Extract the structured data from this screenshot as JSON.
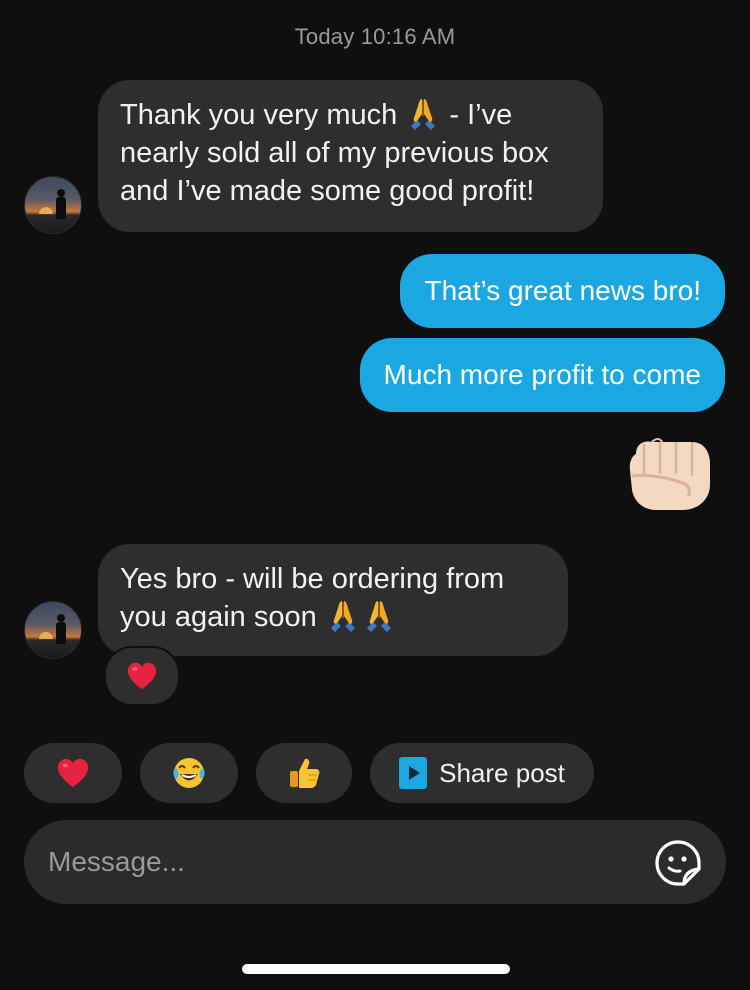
{
  "conversation": {
    "timestamp": "Today 10:16 AM"
  },
  "messages": {
    "m1": {
      "line1_before": "Thank you very much ",
      "line1_after": " - I’ve",
      "line2": "nearly sold all of my previous box",
      "line3": "and I’ve made some good profit!"
    },
    "m2": {
      "text": "That’s great news bro!"
    },
    "m3": {
      "text": "Much more profit to come"
    },
    "m4": {
      "sticker": "fist-bump-emoji"
    },
    "m5": {
      "line1": "Yes bro - will be ordering from",
      "line2_before": "you again soon ",
      "reaction": "red-heart-emoji"
    }
  },
  "quick_replies": {
    "heart": "red-heart-emoji",
    "laugh": "tears-of-joy-emoji",
    "thumbs": "thumbs-up-emoji",
    "share_label": "Share post"
  },
  "composer": {
    "placeholder": "Message..."
  },
  "icons": {
    "share": "play-icon",
    "sticker": "sticker-smiley-icon",
    "pray": "folded-hands-emoji"
  },
  "colors": {
    "background": "#0f0f0f",
    "incoming_bubble": "#2e2e2e",
    "outgoing_bubble": "#1aa7e2",
    "timestamp": "#9a9a9a",
    "heart": "#e8233f"
  }
}
